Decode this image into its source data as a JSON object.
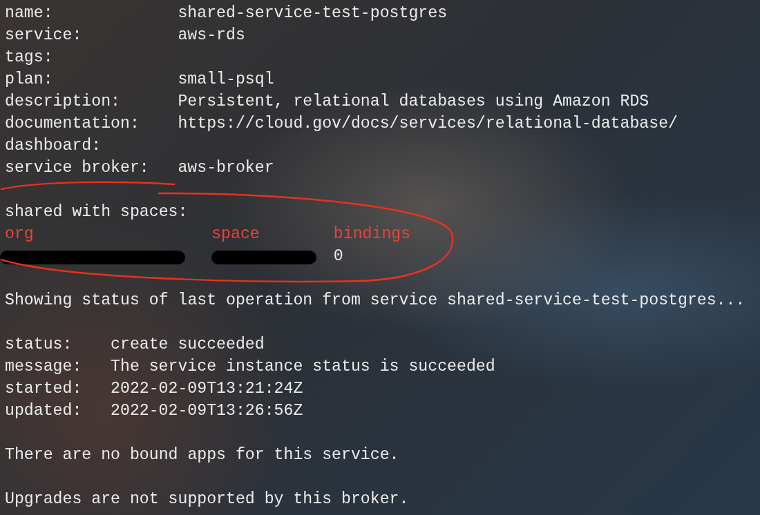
{
  "details": [
    {
      "label": "name:",
      "value": "shared-service-test-postgres"
    },
    {
      "label": "service:",
      "value": "aws-rds"
    },
    {
      "label": "tags:"
    },
    {
      "label": "plan:",
      "value": "small-psql"
    },
    {
      "label": "description:",
      "value": "Persistent, relational databases using Amazon RDS"
    },
    {
      "label": "documentation:",
      "value": "https://cloud.gov/docs/services/relational-database/"
    },
    {
      "label": "dashboard:"
    },
    {
      "label": "service broker:",
      "value": "aws-broker"
    }
  ],
  "shared_with_spaces": {
    "heading": "shared with spaces:",
    "columns": [
      "org",
      "space",
      "bindings"
    ],
    "rows": [
      {
        "org_redacted": true,
        "space_redacted": true,
        "bindings": "0"
      }
    ]
  },
  "operation_heading": "Showing status of last operation from service shared-service-test-postgres...",
  "operation": [
    {
      "label": "status:",
      "value": "create succeeded"
    },
    {
      "label": "message:",
      "value": "The service instance status is succeeded"
    },
    {
      "label": "started:",
      "value": "2022-02-09T13:21:24Z"
    },
    {
      "label": "updated:",
      "value": "2022-02-09T13:26:56Z"
    }
  ],
  "messages": [
    "There are no bound apps for this service.",
    "Upgrades are not supported by this broker."
  ]
}
